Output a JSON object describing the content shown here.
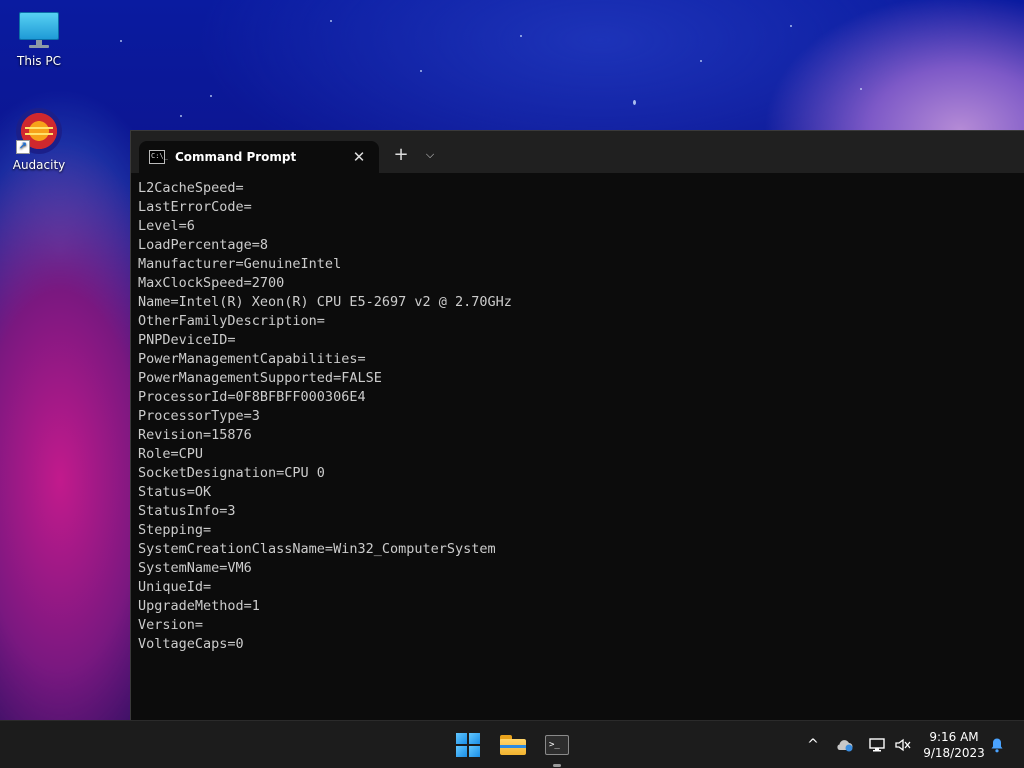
{
  "desktop": {
    "icons": [
      {
        "label": "This PC"
      },
      {
        "label": "Audacity"
      }
    ]
  },
  "terminal": {
    "tab_title": "Command Prompt",
    "close_glyph": "✕",
    "new_tab_glyph": "+",
    "dropdown_glyph": "⌵",
    "lines": [
      "L2CacheSpeed=",
      "LastErrorCode=",
      "Level=6",
      "LoadPercentage=8",
      "Manufacturer=GenuineIntel",
      "MaxClockSpeed=2700",
      "Name=Intel(R) Xeon(R) CPU E5-2697 v2 @ 2.70GHz",
      "OtherFamilyDescription=",
      "PNPDeviceID=",
      "PowerManagementCapabilities=",
      "PowerManagementSupported=FALSE",
      "ProcessorId=0F8BFBFF000306E4",
      "ProcessorType=3",
      "Revision=15876",
      "Role=CPU",
      "SocketDesignation=CPU 0",
      "Status=OK",
      "StatusInfo=3",
      "Stepping=",
      "SystemCreationClassName=Win32_ComputerSystem",
      "SystemName=VM6",
      "UniqueId=",
      "UpgradeMethod=1",
      "Version=",
      "VoltageCaps=0"
    ]
  },
  "taskbar": {
    "apps": [
      {
        "icon": "windows-start-icon"
      },
      {
        "icon": "file-explorer-icon"
      },
      {
        "icon": "terminal-icon"
      }
    ],
    "tray": {
      "chevron": "^",
      "time": "9:16 AM",
      "date": "9/18/2023"
    }
  }
}
